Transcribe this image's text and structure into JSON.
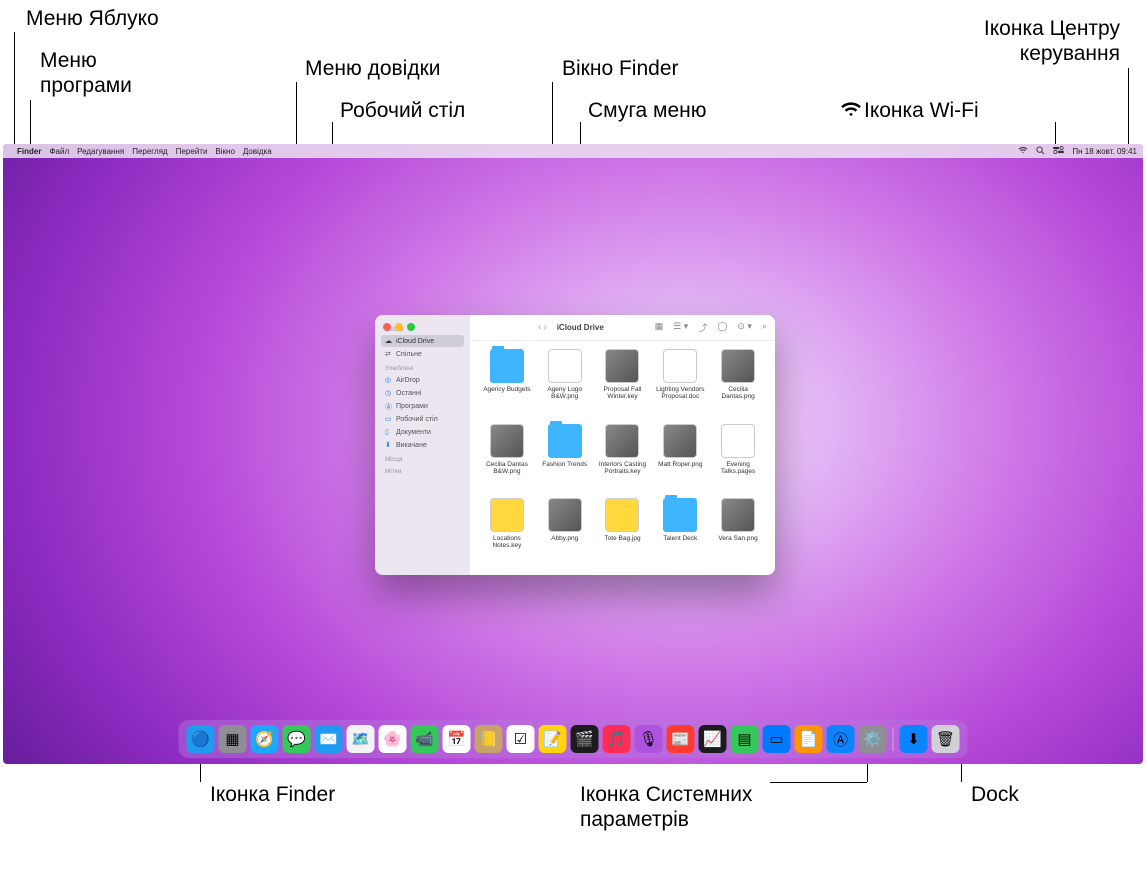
{
  "annotations": {
    "apple_menu": "Меню Яблуко",
    "app_menu": "Меню\nпрограми",
    "help_menu": "Меню довідки",
    "desktop": "Робочий стіл",
    "finder_window": "Вікно Finder",
    "menu_bar": "Смуга меню",
    "control_center": "Іконка Центру\nкерування",
    "wifi_icon": "Іконка Wi-Fi",
    "finder_icon": "Іконка Finder",
    "sysprefs_icon": "Іконка Системних\nпараметрів",
    "dock": "Dock"
  },
  "menubar": {
    "app": "Finder",
    "items": [
      "Файл",
      "Редагування",
      "Перегляд",
      "Перейти",
      "Вікно",
      "Довідка"
    ],
    "clock": "Пн 18 жовт.  09:41"
  },
  "finder": {
    "title": "iCloud Drive",
    "sidebar": {
      "section1": "iCloud",
      "icloud_drive": "iCloud Drive",
      "shared": "Спільне",
      "section2": "Улюблені",
      "airdrop": "AirDrop",
      "recent": "Останні",
      "apps": "Програми",
      "desktop": "Робочий стіл",
      "documents": "Документи",
      "downloads": "Викачане",
      "section3": "Місця",
      "section4": "Мітки"
    },
    "files": [
      {
        "name": "Agency Budgets",
        "kind": "folder"
      },
      {
        "name": "Ageny Logo B&W.png",
        "kind": "doc"
      },
      {
        "name": "Proposal Fall Winter.key",
        "kind": "img"
      },
      {
        "name": "Lighting Vendors Proposal.doc",
        "kind": "doc"
      },
      {
        "name": "Cecilia Dantas.png",
        "kind": "img"
      },
      {
        "name": "Cecilia Dantas B&W.png",
        "kind": "img"
      },
      {
        "name": "Fashion Trends",
        "kind": "folder"
      },
      {
        "name": "Interiors Casting Portraits.key",
        "kind": "img"
      },
      {
        "name": "Matt Roper.png",
        "kind": "img"
      },
      {
        "name": "Evening Talks.pages",
        "kind": "doc"
      },
      {
        "name": "Locations Notes.key",
        "kind": "yel"
      },
      {
        "name": "Abby.png",
        "kind": "img"
      },
      {
        "name": "Tote Bag.jpg",
        "kind": "yel"
      },
      {
        "name": "Talent Deck",
        "kind": "folder"
      },
      {
        "name": "Vera San.png",
        "kind": "img"
      }
    ]
  },
  "dock": {
    "apps": [
      {
        "n": "finder",
        "c": "#1e9bf0",
        "g": "🔵"
      },
      {
        "n": "launchpad",
        "c": "#8e8e93",
        "g": "▦"
      },
      {
        "n": "safari",
        "c": "#1ea7fd",
        "g": "🧭"
      },
      {
        "n": "messages",
        "c": "#34c759",
        "g": "💬"
      },
      {
        "n": "mail",
        "c": "#1e9bf0",
        "g": "✉️"
      },
      {
        "n": "maps",
        "c": "#f2f2f7",
        "g": "🗺️"
      },
      {
        "n": "photos",
        "c": "#fff",
        "g": "🌸"
      },
      {
        "n": "facetime",
        "c": "#34c759",
        "g": "📹"
      },
      {
        "n": "calendar",
        "c": "#fff",
        "g": "📅"
      },
      {
        "n": "contacts",
        "c": "#c7a36a",
        "g": "📒"
      },
      {
        "n": "reminders",
        "c": "#fff",
        "g": "☑︎"
      },
      {
        "n": "notes",
        "c": "#ffd60a",
        "g": "📝"
      },
      {
        "n": "tv",
        "c": "#1c1c1e",
        "g": "🎬"
      },
      {
        "n": "music",
        "c": "#ff2d55",
        "g": "🎵"
      },
      {
        "n": "podcasts",
        "c": "#af52de",
        "g": "🎙"
      },
      {
        "n": "news",
        "c": "#ff3b30",
        "g": "📰"
      },
      {
        "n": "stocks",
        "c": "#1c1c1e",
        "g": "📈"
      },
      {
        "n": "numbers",
        "c": "#34c759",
        "g": "▤"
      },
      {
        "n": "keynote",
        "c": "#007aff",
        "g": "▭"
      },
      {
        "n": "pages",
        "c": "#ff9500",
        "g": "📄"
      },
      {
        "n": "appstore",
        "c": "#0a84ff",
        "g": "Ⓐ"
      },
      {
        "n": "sysprefs",
        "c": "#8e8e93",
        "g": "⚙️"
      }
    ],
    "right": [
      {
        "n": "downloads",
        "c": "#0a84ff",
        "g": "⬇︎"
      },
      {
        "n": "trash",
        "c": "#d1d1d6",
        "g": "🗑"
      }
    ]
  }
}
